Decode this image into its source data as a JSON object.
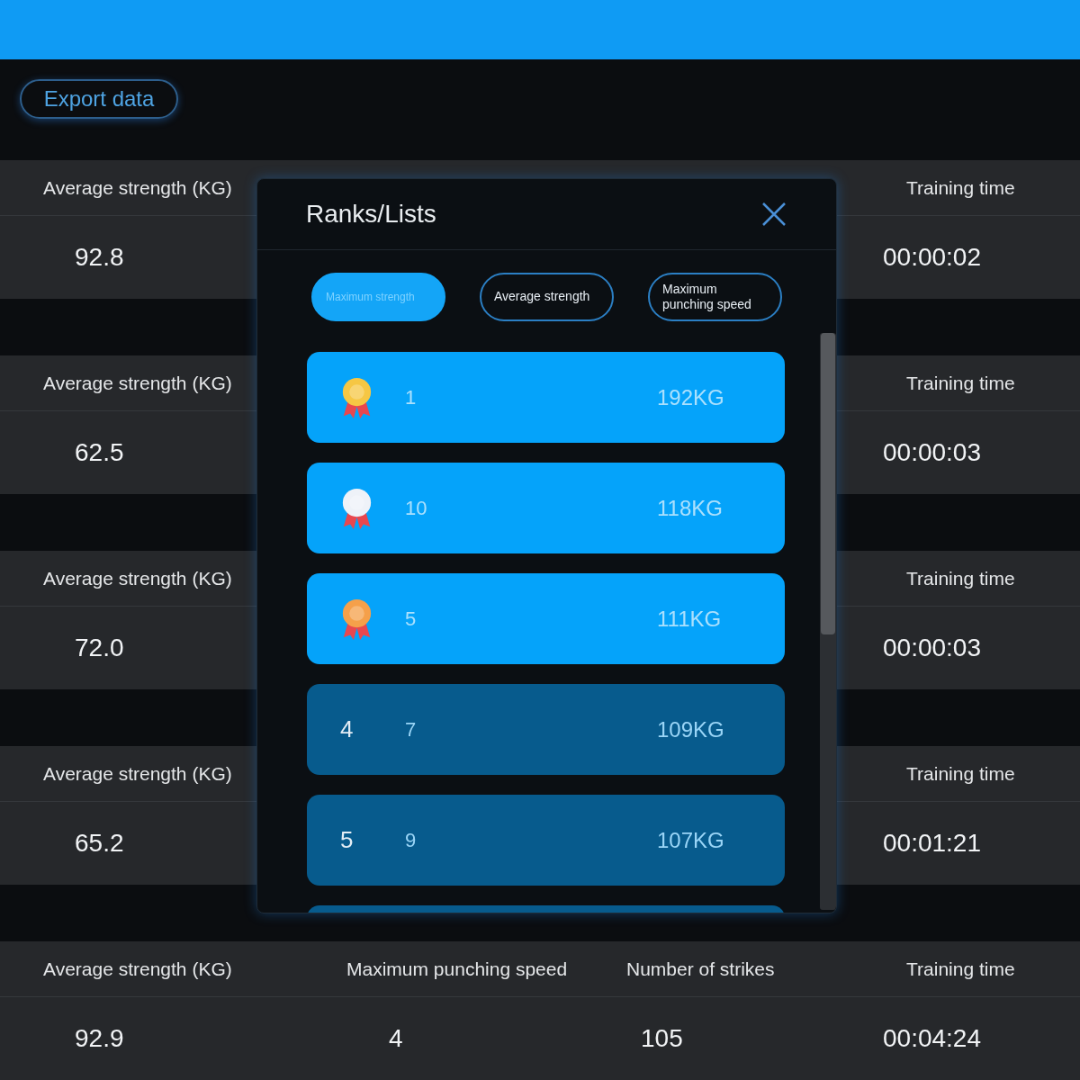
{
  "toolbar": {
    "export_button": "Export data"
  },
  "records": [
    {
      "average_strength": {
        "label": "Average strength (KG)",
        "value": "92.8"
      },
      "training_time": {
        "label": "Training time",
        "value": "00:00:02"
      }
    },
    {
      "average_strength": {
        "label": "Average strength (KG)",
        "value": "62.5"
      },
      "training_time": {
        "label": "Training time",
        "value": "00:00:03"
      }
    },
    {
      "average_strength": {
        "label": "Average strength (KG)",
        "value": "72.0"
      },
      "training_time": {
        "label": "Training time",
        "value": "00:00:03"
      }
    },
    {
      "average_strength": {
        "label": "Average strength (KG)",
        "value": "65.2"
      },
      "training_time": {
        "label": "Training time",
        "value": "00:01:21"
      }
    },
    {
      "average_strength": {
        "label": "Average strength (KG)",
        "value": "92.9"
      },
      "max_punching_speed": {
        "label": "Maximum punching speed",
        "value": "4"
      },
      "strike_count": {
        "label": "Number of strikes",
        "value": "105"
      },
      "training_time": {
        "label": "Training time",
        "value": "00:04:24"
      }
    }
  ],
  "ranks_dialog": {
    "title": "Ranks/Lists",
    "tabs": [
      {
        "label": "Maximum strength",
        "selected": true
      },
      {
        "label": "Average strength",
        "selected": false
      },
      {
        "label": "Maximum punching speed",
        "selected": false
      }
    ],
    "rows": [
      {
        "kind": "medal",
        "color": "#f6c744",
        "name": "1",
        "value": "192KG"
      },
      {
        "kind": "medal",
        "color": "#eef2f8",
        "name": "10",
        "value": "118KG"
      },
      {
        "kind": "medal",
        "color": "#f5a04a",
        "name": "5",
        "value": "111KG"
      },
      {
        "kind": "rank",
        "rank": "4",
        "name": "7",
        "value": "109KG"
      },
      {
        "kind": "rank",
        "rank": "5",
        "name": "9",
        "value": "107KG"
      },
      {
        "kind": "rank"
      }
    ]
  }
}
